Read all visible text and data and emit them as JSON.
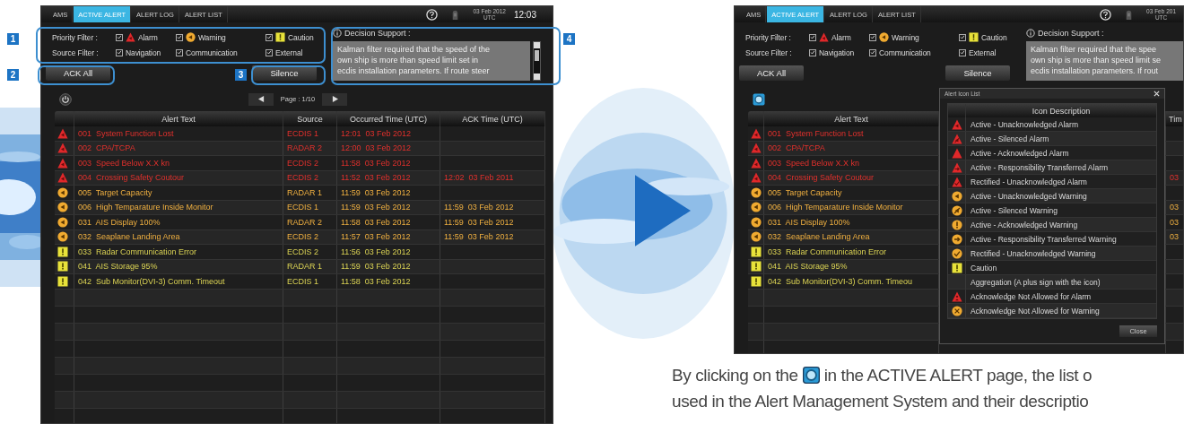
{
  "left_screen": {
    "tabs": [
      {
        "label": "AMS",
        "selected": false
      },
      {
        "label": "ACTIVE ALERT",
        "selected": true
      },
      {
        "label": "ALERT LOG",
        "selected": false
      },
      {
        "label": "ALERT LIST",
        "selected": false
      }
    ],
    "date": "03 Feb 2012",
    "timezone": "UTC",
    "clock": "12:03",
    "filters": [
      {
        "label": "Priority Filter :",
        "options": [
          {
            "label": "Alarm",
            "kind": "alarm",
            "checked": true
          },
          {
            "label": "Warning",
            "kind": "warning",
            "checked": true
          },
          {
            "label": "Caution",
            "kind": "caution",
            "checked": true
          }
        ]
      },
      {
        "label": "Source Filter :",
        "options": [
          {
            "label": "Navigation",
            "checked": true
          },
          {
            "label": "Communication",
            "checked": true
          },
          {
            "label": "External",
            "checked": true
          }
        ]
      }
    ],
    "buttons": [
      "ACK All",
      "Silence"
    ],
    "decision_support": {
      "title": "Decision Support :",
      "lines": [
        "Kalman filter required that the speed of the",
        "own ship is more than speed limit set in",
        "ecdis installation parameters. If route steer"
      ]
    },
    "pager": "Page : 1/10",
    "table": {
      "columns": [
        "Alert Text",
        "Source",
        "Occurred Time (UTC)",
        "ACK Time (UTC)"
      ],
      "rows": [
        {
          "kind": "alarm",
          "text": "001  System Function Lost",
          "source": "ECDIS 1",
          "occurred": "12:01  03 Feb 2012"
        },
        {
          "kind": "alarm",
          "text": "002  CPA/TCPA",
          "source": "RADAR 2",
          "occurred": "12:00  03 Feb 2012"
        },
        {
          "kind": "alarm",
          "text": "003  Speed Below X.X kn",
          "source": "ECDIS 2",
          "occurred": "11:58  03 Feb 2012"
        },
        {
          "kind": "alarm",
          "text": "004  Crossing Safety Coutour",
          "source": "ECDIS 2",
          "occurred": "11:52  03 Feb 2012",
          "ack": "12:02  03 Feb 2011"
        },
        {
          "kind": "warning",
          "text": "005  Target Capacity",
          "source": "RADAR 1",
          "occurred": "11:59  03 Feb 2012"
        },
        {
          "kind": "warning",
          "text": "006  High Temparature Inside Monitor",
          "source": "ECDIS 1",
          "occurred": "11:59  03 Feb 2012",
          "ack": "11:59  03 Feb 2012"
        },
        {
          "kind": "warning",
          "text": "031  AIS Display 100%",
          "source": "RADAR 2",
          "occurred": "11:58  03 Feb 2012",
          "ack": "11:59  03 Feb 2012"
        },
        {
          "kind": "warning",
          "text": "032  Seaplane Landing Area",
          "source": "ECDIS 2",
          "occurred": "11:57  03 Feb 2012",
          "ack": "11:59  03 Feb 2012"
        },
        {
          "kind": "caution",
          "text": "033  Radar Communication Error",
          "source": "ECDIS 2",
          "occurred": "11:56  03 Feb 2012"
        },
        {
          "kind": "caution",
          "text": "041  AIS Storage 95%",
          "source": "RADAR 1",
          "occurred": "11:59  03 Feb 2012"
        },
        {
          "kind": "caution",
          "text": "042  Sub Monitor(DVI-3) Comm. Timeout",
          "source": "ECDIS 1",
          "occurred": "11:58  03 Feb 2012"
        }
      ]
    }
  },
  "callouts": [
    "1",
    "2",
    "3",
    "4"
  ],
  "right_screen": {
    "tabs": [
      {
        "label": "AMS",
        "selected": false
      },
      {
        "label": "ACTIVE ALERT",
        "selected": true
      },
      {
        "label": "ALERT LOG",
        "selected": false
      },
      {
        "label": "ALERT LIST",
        "selected": false
      }
    ],
    "date": "03 Feb 201",
    "timezone": "UTC",
    "filters": [
      {
        "label": "Priority Filter :",
        "options": [
          {
            "label": "Alarm",
            "kind": "alarm",
            "checked": true
          },
          {
            "label": "Warning",
            "kind": "warning",
            "checked": true
          },
          {
            "label": "Caution",
            "kind": "caution",
            "checked": true
          }
        ]
      },
      {
        "label": "Source Filter :",
        "options": [
          {
            "label": "Navigation",
            "checked": true
          },
          {
            "label": "Communication",
            "checked": true
          },
          {
            "label": "External",
            "checked": true
          }
        ]
      }
    ],
    "buttons": [
      "ACK All",
      "Silence"
    ],
    "decision_support": {
      "title": "Decision Support :",
      "lines": [
        "Kalman filter required that the spee",
        "own ship is more than speed limit se",
        "ecdis installation parameters. If rout"
      ]
    },
    "table": {
      "columns": [
        "Alert Text",
        "Tim"
      ],
      "rows": [
        {
          "kind": "alarm",
          "text": "001  System Function Lost"
        },
        {
          "kind": "alarm",
          "text": "002  CPA/TCPA"
        },
        {
          "kind": "alarm",
          "text": "003  Speed Below X.X kn"
        },
        {
          "kind": "alarm",
          "text": "004  Crossing Safety Coutour",
          "column_4": "03"
        },
        {
          "kind": "warning",
          "text": "005  Target Capacity"
        },
        {
          "kind": "warning",
          "text": "006  High Temparature Inside Monitor",
          "column_4": "03"
        },
        {
          "kind": "warning",
          "text": "031  AIS Display 100%",
          "column_4": "03"
        },
        {
          "kind": "warning",
          "text": "032  Seaplane Landing Area",
          "column_4": "03"
        },
        {
          "kind": "caution",
          "text": "033  Radar Communication Error"
        },
        {
          "kind": "caution",
          "text": "041  AIS Storage 95%"
        },
        {
          "kind": "caution",
          "text": "042  Sub Monitor(DVI-3) Comm. Timeou"
        }
      ]
    },
    "dialog": {
      "title": "Alert Icon List",
      "header": "Icon Description",
      "button": "Close",
      "items": [
        {
          "kind": "alarm_unacknowledged",
          "label": "Active - Unacknowledged Alarm"
        },
        {
          "kind": "alarm_silenced",
          "label": "Active - Silenced Alarm"
        },
        {
          "kind": "alarm_acknowledged",
          "label": "Active - Acknowledged Alarm"
        },
        {
          "kind": "alarm_transferred",
          "label": "Active - Responsibility Transferred Alarm"
        },
        {
          "kind": "alarm_rectified",
          "label": "Rectified - Unacknowledged Alarm"
        },
        {
          "kind": "warning_unacknowledged",
          "label": "Active - Unacknowledged Warning"
        },
        {
          "kind": "warning_silenced",
          "label": "Active - Silenced Warning"
        },
        {
          "kind": "warning_acknowledged",
          "label": "Active - Acknowledged Warning"
        },
        {
          "kind": "warning_transferred",
          "label": "Active - Responsibility Transferred Warning"
        },
        {
          "kind": "warning_rectified",
          "label": "Rectified - Unacknowledged Warning"
        },
        {
          "kind": "caution",
          "label": "Caution"
        },
        {
          "kind": "aggregation",
          "label": "Aggregation (A plus sign with the icon)"
        },
        {
          "kind": "alarm_not_allowed",
          "label": "Acknowledge Not Allowed for Alarm"
        },
        {
          "kind": "warning_not_allowed",
          "label": "Acknowledge Not Allowed for Warning"
        }
      ]
    }
  },
  "caption": {
    "before_icon": "By clicking on the",
    "after_icon": "in the ACTIVE ALERT page, the list o",
    "line_2": "used in the Alert Management System and their descriptio"
  }
}
